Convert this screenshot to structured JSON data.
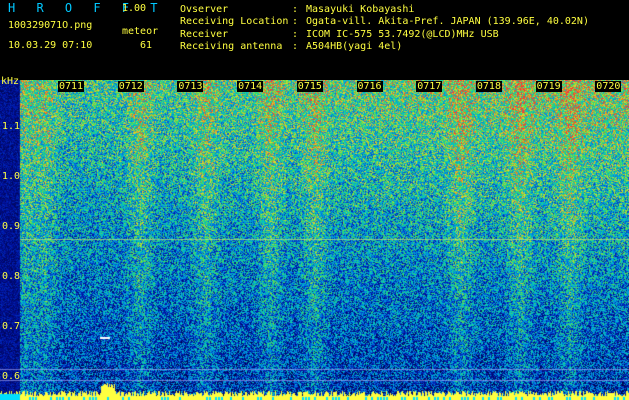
{
  "header": {
    "app_name": "H R O F F T",
    "version": "1.00",
    "filename": "100329071O.png",
    "meteor_label": "meteor",
    "datetime": "10.03.29 07:10",
    "meteor_count": "61",
    "info": [
      {
        "label": "Ovserver",
        "value": "Masayuki Kobayashi"
      },
      {
        "label": "Receiving Location",
        "value": "Ogata-vill. Akita-Pref. JAPAN (139.96E, 40.02N)"
      },
      {
        "label": "Receiver",
        "value": "ICOM IC-575 53.7492(@LCD)MHz USB"
      },
      {
        "label": "Receiving antenna",
        "value": "A504HB(yagi 4el)"
      }
    ]
  },
  "spectrogram": {
    "freq_unit": "kHz",
    "y_ticks": [
      "1.1",
      "1.0",
      "0.9",
      "0.8",
      "0.7",
      "0.6"
    ],
    "time_ticks": [
      "0711",
      "0712",
      "0713",
      "0714",
      "0715",
      "0716",
      "0717",
      "0718",
      "0719",
      "0720"
    ],
    "colors": {
      "text": "#ffff40",
      "title": "#00c8ff",
      "background": "#000000"
    }
  }
}
